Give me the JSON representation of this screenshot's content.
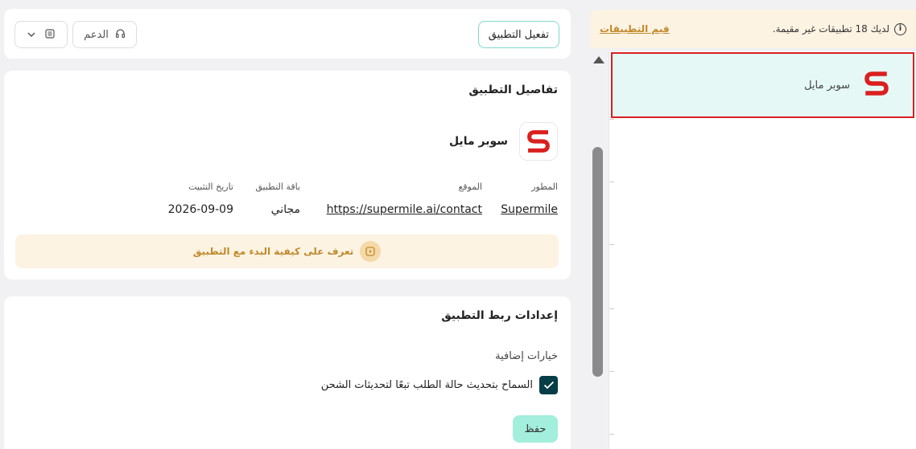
{
  "notice": {
    "message": "لديك 18 تطبيقات غير مقيمة.",
    "rate_link": "قيم التطبيقات"
  },
  "app_list": {
    "items": [
      {
        "name": "سوبر مايل",
        "icon": "supermile-s-logo"
      }
    ]
  },
  "top_bar": {
    "activate_label": "تفعيل التطبيق",
    "support_label": "الدعم",
    "support_icon": "headset-icon",
    "menu_icon": "list-icon",
    "menu_chevron": "chevron-down-icon"
  },
  "details": {
    "title": "تفاصيل التطبيق",
    "app_name": "سوبر مايل",
    "developer_label": "المطور",
    "developer_value": "Supermile",
    "site_label": "الموقع",
    "site_value": "https://supermile.ai/contact",
    "plan_label": "باقة التطبيق",
    "plan_value": "مجاني",
    "install_label": "تاريخ التثبيت",
    "install_value": "2026-09-09",
    "getting_started": "تعرف على كيفية البدء مع التطبيق"
  },
  "settings": {
    "title": "إعدادات ربط التطبيق",
    "extra_options_label": "خيارات إضافية",
    "option_label": "السماح بتحديث حالة الطلب تبعًا لتحديثات الشحن",
    "option_checked": true,
    "save_label": "حفظ"
  },
  "colors": {
    "brand_red": "#d9201f",
    "accent_teal": "#a3eedd",
    "notice_bg": "#fdf3e3",
    "notice_link": "#c18a2c",
    "selected_bg": "#e5f8f6",
    "checkbox": "#063d46"
  }
}
